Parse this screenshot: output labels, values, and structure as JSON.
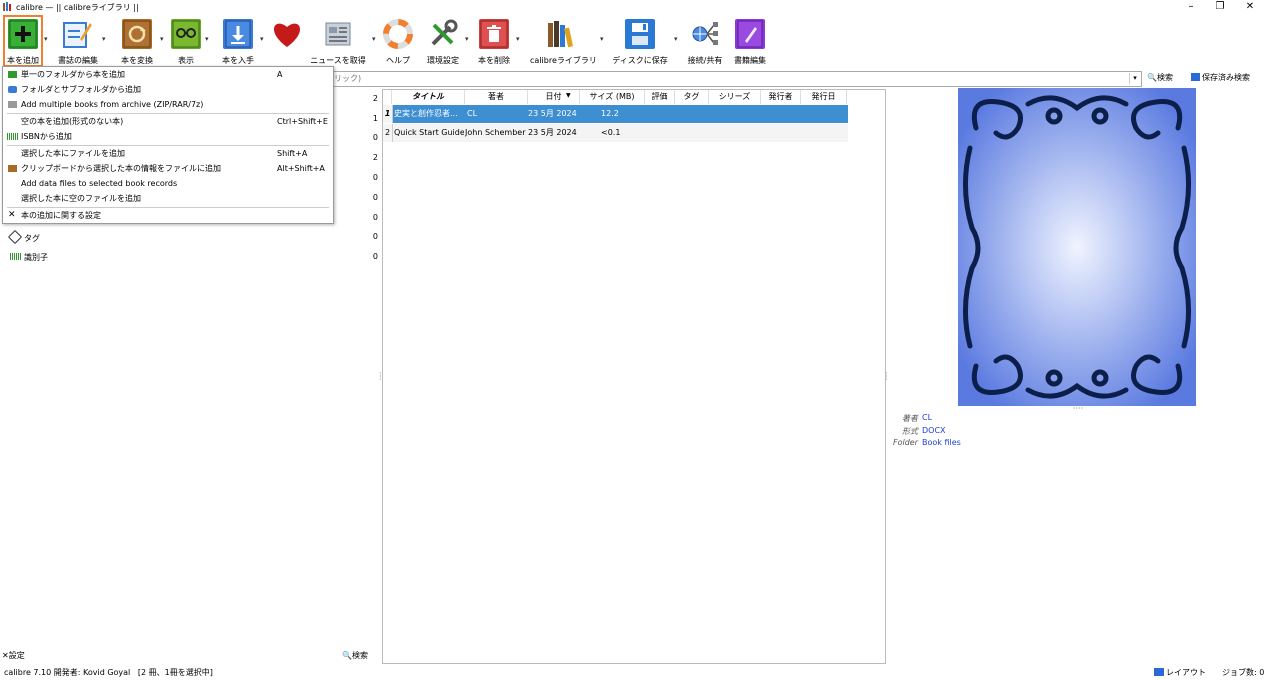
{
  "window": {
    "title": "calibre — || calibreライブラリ ||",
    "controls": [
      "–",
      "❐",
      "✕"
    ]
  },
  "toolbar": [
    {
      "label": "本を追加",
      "icon": "add-book-icon",
      "color": "#2e9a2e"
    },
    {
      "label": "書誌の編集",
      "icon": "edit-metadata-icon",
      "color": "#3a7bd5"
    },
    {
      "label": "本を変換",
      "icon": "convert-book-icon",
      "color": "#a86b2a"
    },
    {
      "label": "表示",
      "icon": "view-book-icon",
      "color": "#6aa82a"
    },
    {
      "label": "本を入手",
      "icon": "get-books-icon",
      "color": "#3a7bd5"
    },
    {
      "label": "",
      "icon": "donate-heart-icon",
      "color": "#c41a1a"
    },
    {
      "label": "ニュースを取得",
      "icon": "fetch-news-icon",
      "color": "#8899aa"
    },
    {
      "label": "ヘルプ",
      "icon": "help-lifebuoy-icon",
      "color": "#f08030"
    },
    {
      "label": "環境設定",
      "icon": "preferences-tools-icon",
      "color": "#555555"
    },
    {
      "label": "本を削除",
      "icon": "remove-book-icon",
      "color": "#d04040"
    },
    {
      "label": "calibreライブラリ",
      "icon": "library-icon",
      "color": "#8a5a2a"
    },
    {
      "label": "ディスクに保存",
      "icon": "save-disk-icon",
      "color": "#2a7ad5"
    },
    {
      "label": "接続/共有",
      "icon": "connect-share-icon",
      "color": "#3a6aa5"
    },
    {
      "label": "書籍編集",
      "icon": "edit-book-icon",
      "color": "#8a3ad5"
    }
  ],
  "search": {
    "placeholder_tail": "リック)",
    "search_label": "検索",
    "saved_search_label": "保存済み検索"
  },
  "add_menu": {
    "items": [
      {
        "label": "単一のフォルダから本を追加",
        "shortcut": "A",
        "icon": "folder-green-icon"
      },
      {
        "label": "フォルダとサブフォルダから追加",
        "shortcut": "",
        "icon": "folders-blue-icon"
      },
      {
        "label": "Add multiple books from archive (ZIP/RAR/7z)",
        "shortcut": "",
        "icon": "archive-icon"
      },
      {
        "label": "空の本を追加(形式のない本)",
        "shortcut": "Ctrl+Shift+E",
        "icon": ""
      },
      {
        "label": "ISBNから追加",
        "shortcut": "",
        "icon": "isbn-barcode-icon"
      },
      {
        "label": "選択した本にファイルを追加",
        "shortcut": "Shift+A",
        "icon": ""
      },
      {
        "label": "クリップボードから選択した本の情報をファイルに追加",
        "shortcut": "Alt+Shift+A",
        "icon": "clipboard-icon"
      },
      {
        "label": "Add data files to selected book records",
        "shortcut": "",
        "icon": ""
      },
      {
        "label": "選択した本に空のファイルを追加",
        "shortcut": "",
        "icon": ""
      },
      {
        "label": "本の追加に関する設定",
        "shortcut": "",
        "icon": "settings-tools-icon"
      }
    ]
  },
  "tag_browser": {
    "counts": [
      "2",
      "1",
      "0",
      "2",
      "0",
      "0",
      "0",
      "0",
      "0",
      "0"
    ],
    "visible_items": [
      {
        "label": "タグ",
        "count": "0",
        "icon": "tag-icon"
      },
      {
        "label": "識別子",
        "count": "0",
        "icon": "identifier-barcode-icon"
      }
    ],
    "settings_label": "設定",
    "find_label": "検索"
  },
  "book_table": {
    "columns": [
      "タイトル",
      "著者",
      "日付",
      "サイズ (MB)",
      "評価",
      "タグ",
      "シリーズ",
      "発行者",
      "発行日"
    ],
    "rows": [
      {
        "num": "1",
        "title": "史実と創作忍者...",
        "author": "CL",
        "date": "23 5月 2024",
        "size": "12.2",
        "selected": true
      },
      {
        "num": "2",
        "title": "Quick Start Guide",
        "author": "John Schember",
        "date": "23 5月 2024",
        "size": "<0.1",
        "selected": false
      }
    ]
  },
  "book_details": {
    "fields": [
      {
        "label": "著者",
        "value": "CL"
      },
      {
        "label": "形式",
        "value": "DOCX"
      },
      {
        "label": "Folder",
        "value": "Book files"
      }
    ]
  },
  "statusbar": {
    "left": "calibre 7.10 開発者: Kovid Goyal   [2 冊、1冊を選択中]",
    "layout_label": "レイアウト",
    "jobs_label": "ジョブ数: 0"
  }
}
